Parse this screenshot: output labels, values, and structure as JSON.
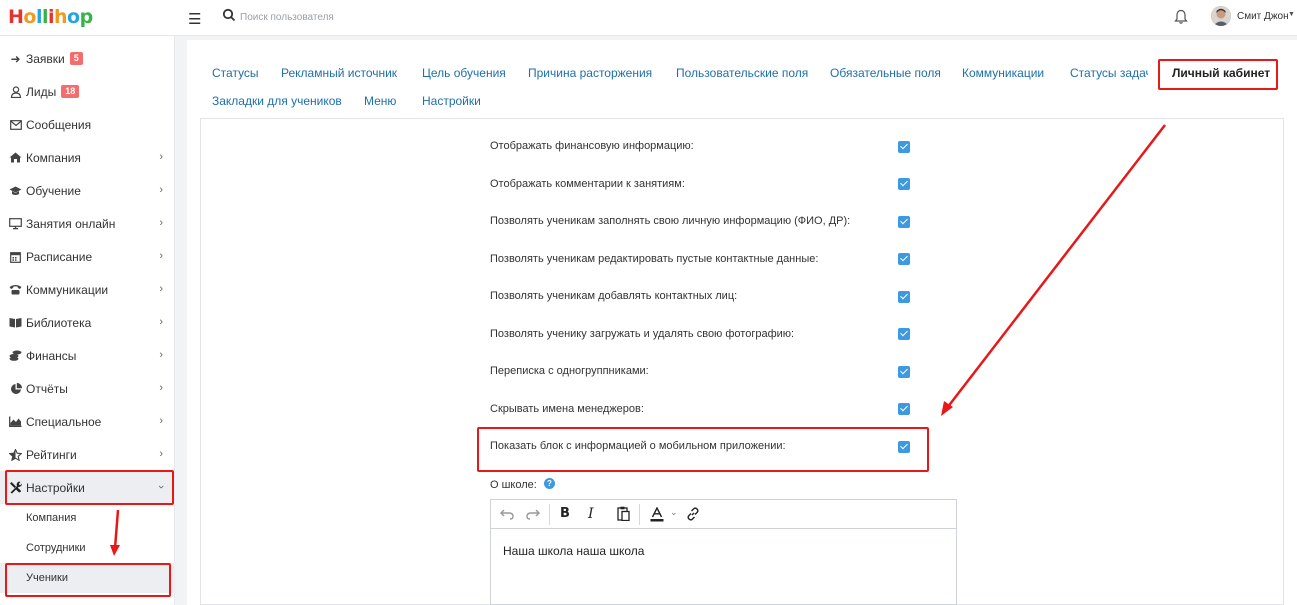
{
  "app": {
    "logo_text": "Hollihop",
    "logo_colors": [
      "#e8322e",
      "#f29a1f",
      "#23a6e0",
      "#37b34a",
      "#e8322e",
      "#f29a1f",
      "#23a6e0",
      "#37b34a"
    ]
  },
  "header": {
    "search_placeholder": "Поиск пользователя",
    "user_name": "Смит Джон"
  },
  "sidebar": {
    "items": [
      {
        "label": "Заявки",
        "icon": "sign-in-icon",
        "badge": "5"
      },
      {
        "label": "Лиды",
        "icon": "user-icon",
        "badge": "18"
      },
      {
        "label": "Сообщения",
        "icon": "envelope-icon"
      },
      {
        "label": "Компания",
        "icon": "home-icon"
      },
      {
        "label": "Обучение",
        "icon": "graduation-cap-icon"
      },
      {
        "label": "Занятия онлайн",
        "icon": "monitor-icon"
      },
      {
        "label": "Расписание",
        "icon": "calendar-icon"
      },
      {
        "label": "Коммуникации",
        "icon": "phone-icon"
      },
      {
        "label": "Библиотека",
        "icon": "book-icon"
      },
      {
        "label": "Финансы",
        "icon": "coins-icon"
      },
      {
        "label": "Отчёты",
        "icon": "pie-chart-icon"
      },
      {
        "label": "Специальное",
        "icon": "area-chart-icon"
      },
      {
        "label": "Рейтинги",
        "icon": "star-half-icon"
      },
      {
        "label": "Настройки",
        "icon": "tools-icon"
      }
    ],
    "subitems": [
      {
        "label": "Компания"
      },
      {
        "label": "Сотрудники"
      },
      {
        "label": "Ученики"
      }
    ]
  },
  "tabs": [
    {
      "label": "Статусы"
    },
    {
      "label": "Рекламный источник"
    },
    {
      "label": "Цель обучения"
    },
    {
      "label": "Причина расторжения"
    },
    {
      "label": "Пользовательские поля"
    },
    {
      "label": "Обязательные поля"
    },
    {
      "label": "Коммуникации"
    },
    {
      "label": "Статусы задач"
    },
    {
      "label": "Личный кабинет"
    },
    {
      "label": "Закладки для учеников"
    },
    {
      "label": "Меню"
    },
    {
      "label": "Настройки"
    }
  ],
  "options": [
    {
      "label": "Отображать финансовую информацию:",
      "checked": true
    },
    {
      "label": "Отображать комментарии к занятиям:",
      "checked": true
    },
    {
      "label": "Позволять ученикам заполнять свою личную информацию (ФИО, ДР):",
      "checked": true
    },
    {
      "label": "Позволять ученикам редактировать пустые контактные данные:",
      "checked": true
    },
    {
      "label": "Позволять ученикам добавлять контактных лиц:",
      "checked": true
    },
    {
      "label": "Позволять ученику загружать и удалять свою фотографию:",
      "checked": true
    },
    {
      "label": "Переписка с одногруппниками:",
      "checked": true
    },
    {
      "label": "Скрывать имена менеджеров:",
      "checked": true
    },
    {
      "label": "Показать блок с информацией о мобильном приложении:",
      "checked": true
    }
  ],
  "about": {
    "label": "О школе:",
    "help": "?",
    "text": "Наша школа наша школа"
  },
  "colors": {
    "accent": "#3d9ae0",
    "link": "#1f6fa8",
    "annotation": "#e81818",
    "badge": "#f36d6d"
  }
}
